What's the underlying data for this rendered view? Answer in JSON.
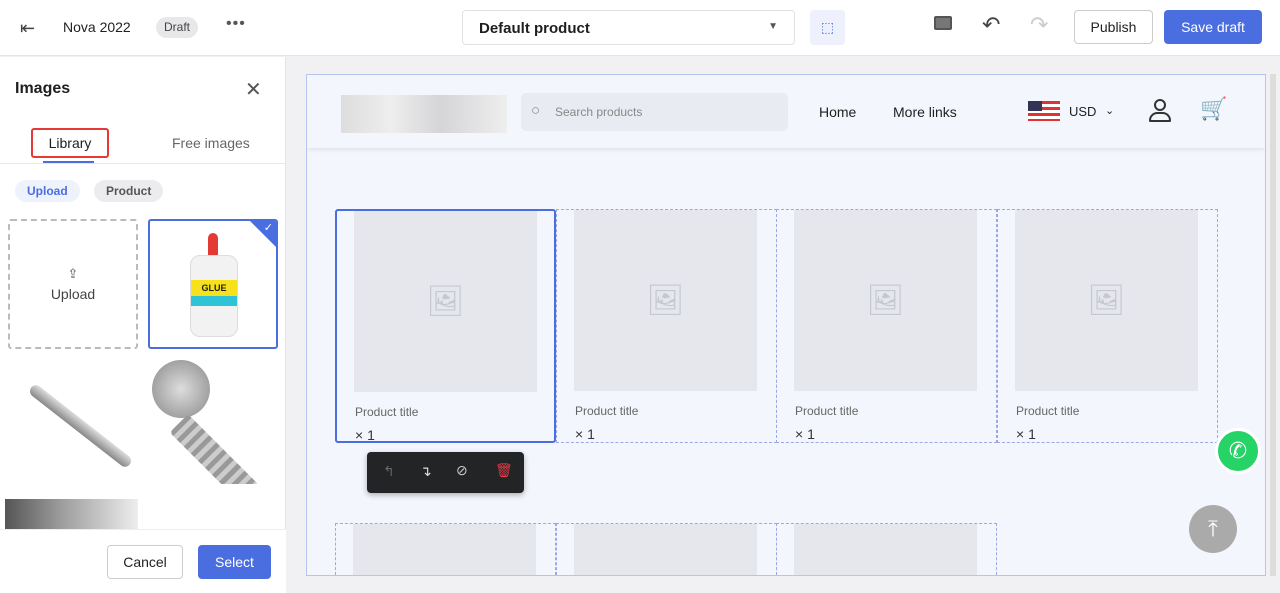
{
  "topbar": {
    "title": "Nova 2022",
    "status": "Draft",
    "template_select": "Default product",
    "publish": "Publish",
    "save_draft": "Save draft"
  },
  "panel": {
    "title": "Images",
    "tabs": [
      {
        "label": "Library",
        "active": true
      },
      {
        "label": "Free images",
        "active": false
      }
    ],
    "filters": [
      {
        "label": "Upload",
        "active": true
      },
      {
        "label": "Product",
        "active": false
      }
    ],
    "upload_label": "Upload",
    "glue_label": "GLUE",
    "cancel": "Cancel",
    "select": "Select"
  },
  "store": {
    "search_placeholder": "Search products",
    "nav": [
      "Home",
      "More links"
    ],
    "currency": "USD"
  },
  "products": [
    {
      "title": "Product title",
      "qty": "× 1"
    },
    {
      "title": "Product title",
      "qty": "× 1"
    },
    {
      "title": "Product title",
      "qty": "× 1"
    },
    {
      "title": "Product title",
      "qty": "× 1"
    }
  ],
  "colors": {
    "accent": "#4a6ee0",
    "highlight": "#e53935",
    "whatsapp": "#25d366"
  }
}
